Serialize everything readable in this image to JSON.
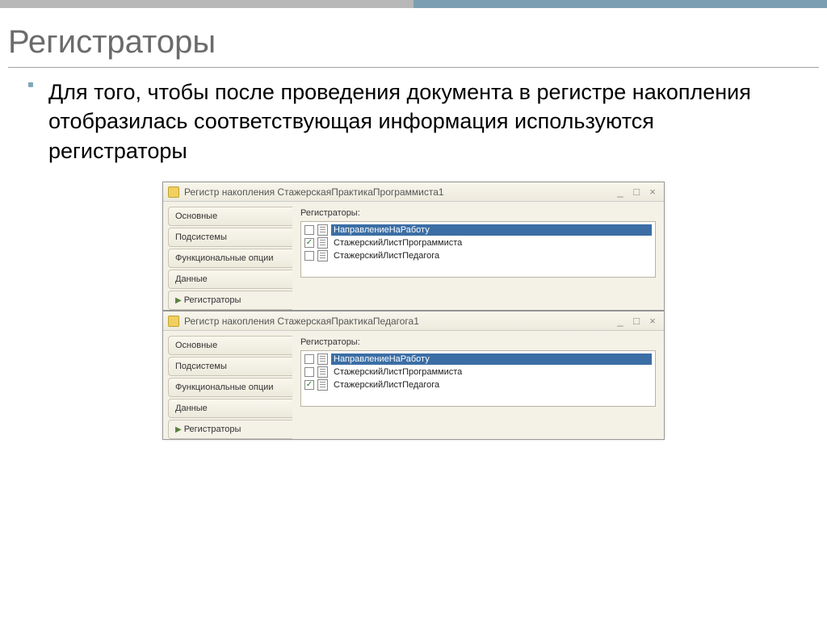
{
  "slide": {
    "heading": "Регистраторы",
    "body": "Для того, чтобы после проведения документа в регистре накопления отобразилась соответствующая информация используются регистраторы"
  },
  "windows": [
    {
      "title": "Регистр накопления СтажерскаяПрактикаПрограммиста1",
      "tabs": [
        "Основные",
        "Подсистемы",
        "Функциональные опции",
        "Данные",
        "Регистраторы"
      ],
      "active_tab": "Регистраторы",
      "content_label": "Регистраторы:",
      "items": [
        {
          "checked": false,
          "label": "НаправлениеНаРаботу",
          "selected": true
        },
        {
          "checked": true,
          "label": "СтажерскийЛистПрограммиста",
          "selected": false
        },
        {
          "checked": false,
          "label": "СтажерскийЛистПедагога",
          "selected": false
        }
      ]
    },
    {
      "title": "Регистр накопления СтажерскаяПрактикаПедагога1",
      "tabs": [
        "Основные",
        "Подсистемы",
        "Функциональные опции",
        "Данные",
        "Регистраторы"
      ],
      "active_tab": "Регистраторы",
      "content_label": "Регистраторы:",
      "items": [
        {
          "checked": false,
          "label": "НаправлениеНаРаботу",
          "selected": true
        },
        {
          "checked": false,
          "label": "СтажерскийЛистПрограммиста",
          "selected": false
        },
        {
          "checked": true,
          "label": "СтажерскийЛистПедагога",
          "selected": false
        }
      ]
    }
  ]
}
